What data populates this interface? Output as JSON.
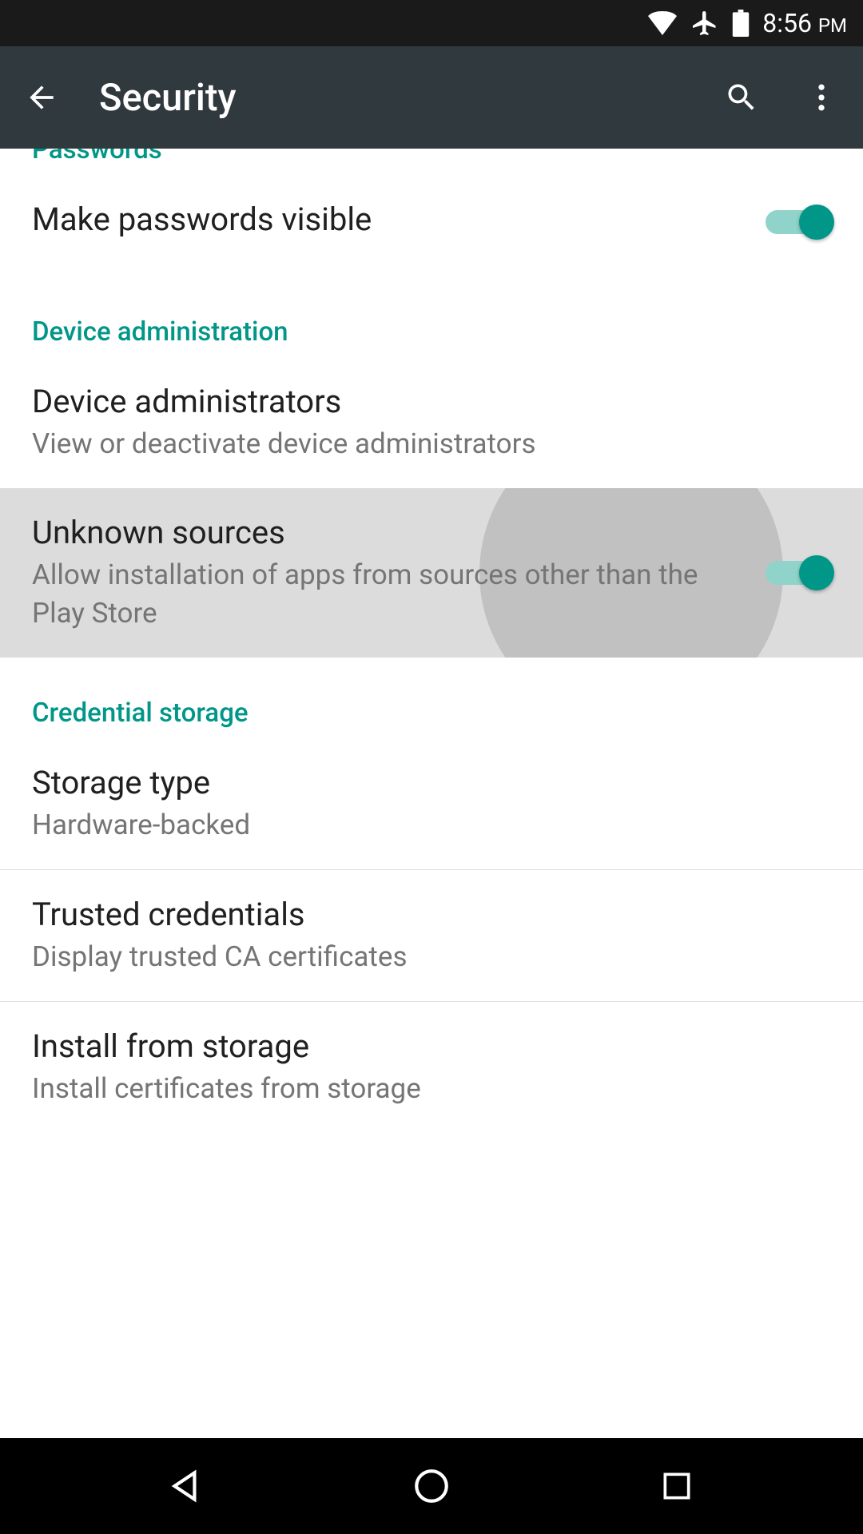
{
  "statusBar": {
    "time": "8:56",
    "meridiem": "PM"
  },
  "appBar": {
    "title": "Security"
  },
  "sections": {
    "passwords": {
      "header": "Passwords",
      "makeVisible": {
        "title": "Make passwords visible"
      }
    },
    "deviceAdmin": {
      "header": "Device administration",
      "administrators": {
        "title": "Device administrators",
        "subtitle": "View or deactivate device administrators"
      },
      "unknownSources": {
        "title": "Unknown sources",
        "subtitle": "Allow installation of apps from sources other than the Play Store"
      }
    },
    "credentialStorage": {
      "header": "Credential storage",
      "storageType": {
        "title": "Storage type",
        "subtitle": "Hardware-backed"
      },
      "trustedCredentials": {
        "title": "Trusted credentials",
        "subtitle": "Display trusted CA certificates"
      },
      "installFromStorage": {
        "title": "Install from storage",
        "subtitle": "Install certificates from storage"
      }
    }
  },
  "colors": {
    "accent": "#009688",
    "appBar": "#30393d",
    "statusBar": "#1a1a1a"
  }
}
